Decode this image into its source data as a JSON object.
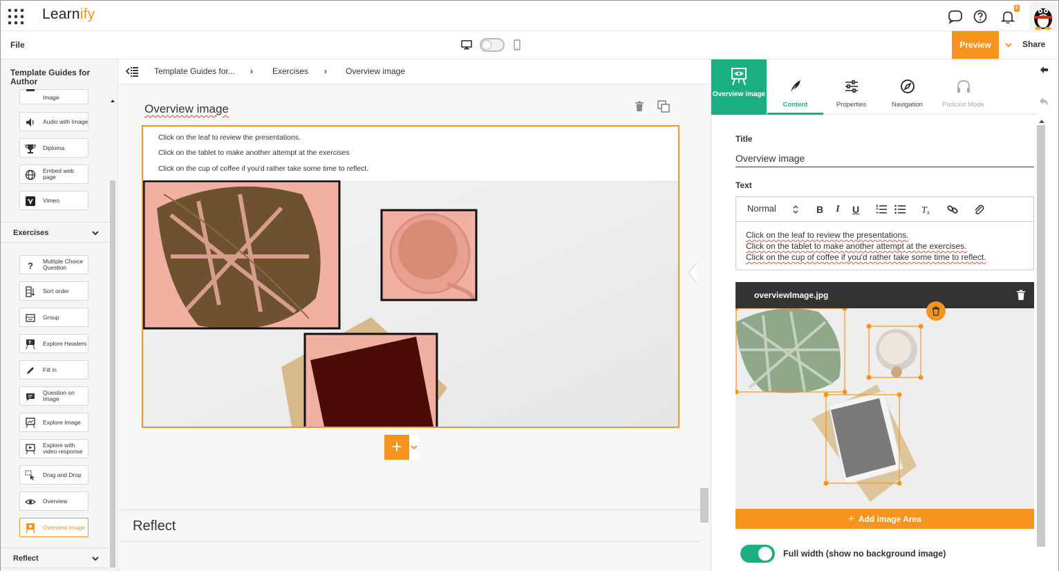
{
  "app": {
    "name_main": "Learn",
    "name_accent": "ify",
    "notification_count": "8"
  },
  "toolbar": {
    "file_label": "File",
    "preview_label": "Preview",
    "share_label": "Share"
  },
  "sidebar": {
    "title": "Template Guides for Author",
    "items_top": [
      {
        "label": "Image",
        "icon": "image-icon"
      },
      {
        "label": "Audio with Image",
        "icon": "audio-icon"
      },
      {
        "label": "Diploma",
        "icon": "trophy-icon"
      },
      {
        "label": "Embed web page",
        "icon": "globe-icon"
      },
      {
        "label": "Vimeo",
        "icon": "vimeo-icon"
      }
    ],
    "section_exercises": "Exercises",
    "items_exercises": [
      {
        "label": "Multiple Choice Question",
        "icon": "question-icon"
      },
      {
        "label": "Sort order",
        "icon": "sort-icon"
      },
      {
        "label": "Group",
        "icon": "group-icon"
      },
      {
        "label": "Explore Headers",
        "icon": "headers-icon"
      },
      {
        "label": "Fill in",
        "icon": "pencil-icon"
      },
      {
        "label": "Question on Image",
        "icon": "comment-icon"
      },
      {
        "label": "Explore Image",
        "icon": "explore-image-icon"
      },
      {
        "label": "Explore with video response",
        "icon": "video-icon"
      },
      {
        "label": "Drag and Drop",
        "icon": "drag-icon"
      },
      {
        "label": "Overview",
        "icon": "eye-icon"
      },
      {
        "label": "Overview image",
        "icon": "overview-image-icon"
      }
    ],
    "section_reflect": "Reflect"
  },
  "breadcrumb": {
    "items": [
      "Template Guides for...",
      "Exercises",
      "Overview image"
    ]
  },
  "block": {
    "title": "Overview image",
    "lines": [
      "Click on the leaf to review the presentations.",
      "Click on the tablet to make another attempt at the exercises",
      "Click on the cup of coffee if you'd rather take some time to reflect."
    ],
    "add_label": "+"
  },
  "next_block": {
    "title": "Reflect"
  },
  "right_panel": {
    "main_tab_label": "Overview image",
    "tabs": [
      {
        "label": "Content",
        "icon": "feather-icon"
      },
      {
        "label": "Properties",
        "icon": "sliders-icon"
      },
      {
        "label": "Navigation",
        "icon": "compass-icon"
      },
      {
        "label": "Podcast Mode",
        "icon": "headphones-icon"
      }
    ],
    "title_label": "Title",
    "title_value": "Overview image",
    "text_label": "Text",
    "format_value": "Normal",
    "editor_lines": [
      "Click on the leaf to review the presentations.",
      "Click on the tablet to make another attempt at the exercises.",
      "Click on the cup of coffee if you'd rather take some time to reflect."
    ],
    "image_filename": "overviewImage.jpg",
    "add_area_label": "Add image Area",
    "full_width_label": "Full width (show no background image)",
    "full_width_on": true
  },
  "colors": {
    "accent": "#f7941d",
    "green": "#1bae82",
    "dark": "#333333"
  }
}
